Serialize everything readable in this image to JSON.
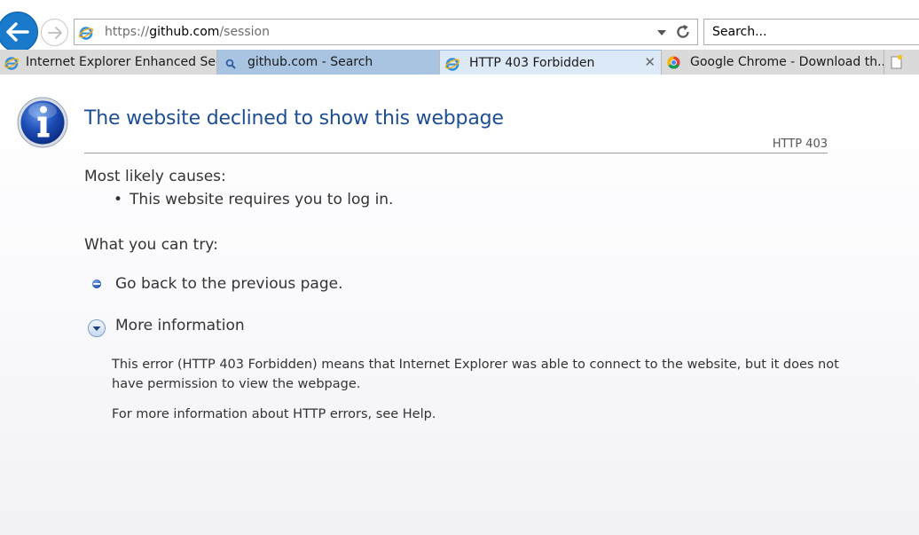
{
  "address_bar": {
    "url_scheme": "https://",
    "url_host": "github.com",
    "url_path": "/session"
  },
  "search": {
    "placeholder": "Search..."
  },
  "tabs": [
    {
      "label": "Internet Explorer Enhanced Sec...",
      "icon": "ie-icon"
    },
    {
      "label": "github.com - Search",
      "icon": "search-icon"
    },
    {
      "label": "HTTP 403 Forbidden",
      "icon": "ie-icon",
      "active": true,
      "close": "✕"
    },
    {
      "label": "Google Chrome - Download th...",
      "icon": "chrome-icon"
    }
  ],
  "page": {
    "title": "The website declined to show this webpage",
    "code": "HTTP 403",
    "causes_heading": "Most likely causes:",
    "causes": [
      "This website requires you to log in."
    ],
    "try_heading": "What you can try:",
    "go_back": "Go back to the previous page.",
    "more_info": "More information",
    "more_p1": "This error (HTTP 403 Forbidden) means that Internet Explorer was able to connect to the website, but it does not have permission to view the webpage.",
    "more_p2": "For more information about HTTP errors, see Help."
  },
  "colors": {
    "title": "#1e4e92",
    "back_button": "#1979ca",
    "active_tab": "#dce9f7",
    "search_tab": "#a9c4e0"
  }
}
